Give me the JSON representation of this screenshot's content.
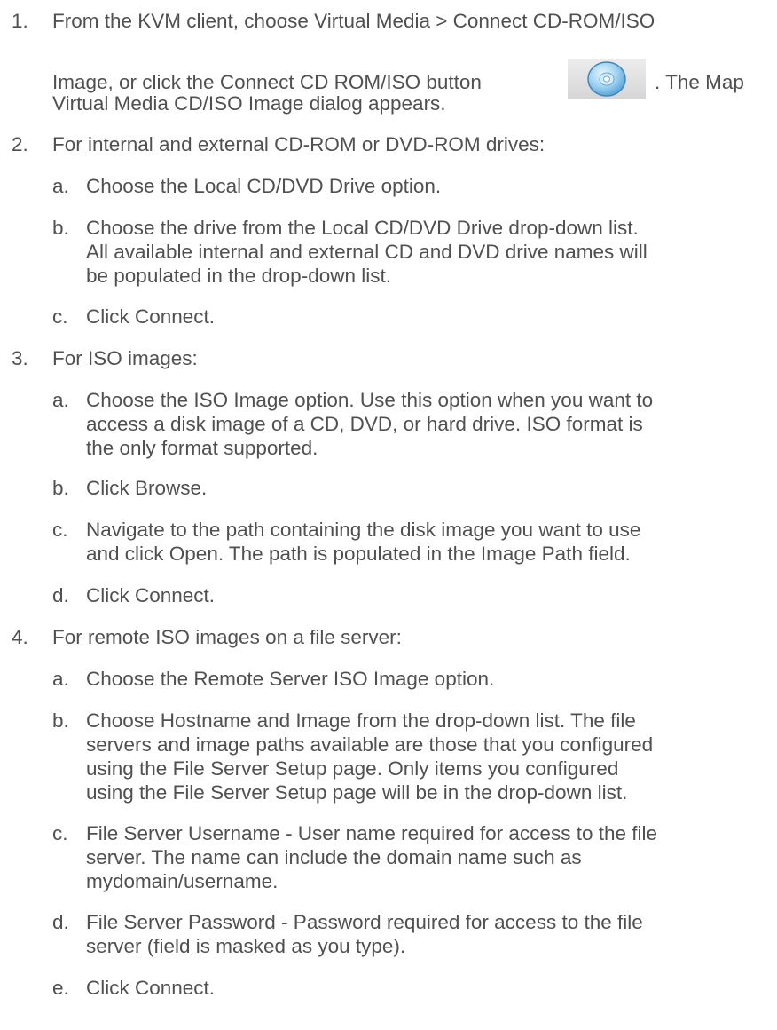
{
  "steps": [
    {
      "num": "1.",
      "lines": [
        "From the KVM client, choose Virtual Media > Connect CD-ROM/ISO",
        "Image, or click the Connect CD ROM/ISO button",
        "Virtual Media CD/ISO Image dialog appears."
      ],
      "after_icon": ". The Map",
      "icon": "cd-disc-icon"
    },
    {
      "num": "2.",
      "lines": [
        "For internal and external CD-ROM or DVD-ROM drives:"
      ]
    },
    {
      "letter": "a.",
      "lines": [
        "Choose the Local CD/DVD Drive option."
      ]
    },
    {
      "letter": "b.",
      "lines": [
        "Choose the drive from the Local CD/DVD Drive drop-down list.",
        "All available internal and external CD and DVD drive names will",
        "be populated in the drop-down list."
      ]
    },
    {
      "letter": "c.",
      "lines": [
        "Click Connect."
      ]
    },
    {
      "num": "3.",
      "lines": [
        "For ISO images:"
      ]
    },
    {
      "letter": "a.",
      "lines": [
        "Choose the ISO Image option. Use this option when you want to",
        "access a disk image of a CD, DVD, or hard drive. ISO format is",
        "the only format supported."
      ]
    },
    {
      "letter": "b.",
      "lines": [
        "Click Browse."
      ]
    },
    {
      "letter": "c.",
      "lines": [
        "Navigate to the path containing the disk image you want to use",
        "and click Open. The path is populated in the Image Path field."
      ]
    },
    {
      "letter": "d.",
      "lines": [
        "Click Connect."
      ]
    },
    {
      "num": "4.",
      "lines": [
        "For remote ISO images on a file server:"
      ]
    },
    {
      "letter": "a.",
      "lines": [
        "Choose the Remote Server ISO Image option."
      ]
    },
    {
      "letter": "b.",
      "lines": [
        "Choose Hostname and Image from the drop-down list. The file",
        "servers and image paths available are those that you configured",
        "using the File Server Setup page. Only items you configured",
        "using the File Server Setup page will be in the drop-down list."
      ]
    },
    {
      "letter": "c.",
      "lines": [
        "File Server Username - User name required for access to the file",
        "server. The name can include the domain name such as",
        "mydomain/username."
      ]
    },
    {
      "letter": "d.",
      "lines": [
        "File Server Password - Password required for access to the file",
        "server (field is masked as you type)."
      ]
    },
    {
      "letter": "e.",
      "lines": [
        "Click Connect."
      ]
    }
  ]
}
